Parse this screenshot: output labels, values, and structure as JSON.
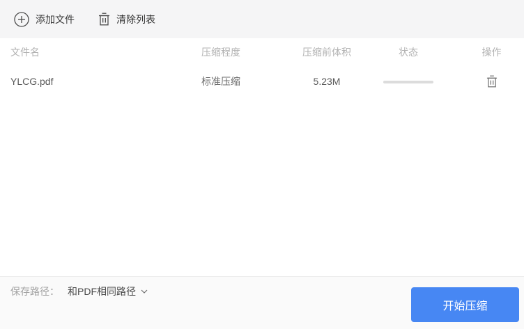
{
  "toolbar": {
    "add_file_label": "添加文件",
    "clear_list_label": "清除列表"
  },
  "table": {
    "headers": {
      "filename": "文件名",
      "level": "压缩程度",
      "size_before": "压缩前体积",
      "status": "状态",
      "action": "操作"
    },
    "rows": [
      {
        "filename": "YLCG.pdf",
        "level": "标准压缩",
        "size_before": "5.23M",
        "progress_percent": 0
      }
    ]
  },
  "footer": {
    "save_path_label": "保存路径：",
    "save_path_value": "和PDF相同路径",
    "start_button_label": "开始压缩"
  },
  "icons": {
    "add": "plus-circle-icon",
    "clear": "trash-icon",
    "row_action": "trash-icon",
    "path_dropdown": "chevron-down-icon"
  },
  "colors": {
    "accent": "#4787f3",
    "toolbar_bg": "#f5f5f6",
    "footer_bg": "#fafafa",
    "progress_track": "#dcdcdc"
  }
}
